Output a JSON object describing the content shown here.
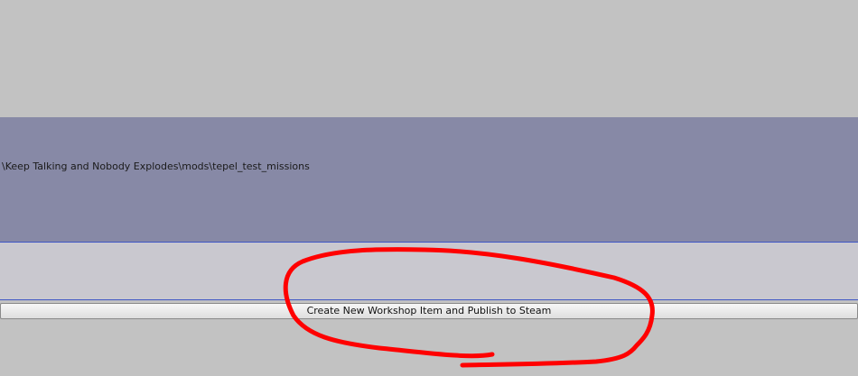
{
  "path_panel": {
    "path": "\\Keep Talking and Nobody Explodes\\mods\\tepel_test_missions"
  },
  "actions": {
    "publish_label": "Create New Workshop Item and Publish to Steam"
  },
  "annotation": {
    "color": "#ff0000"
  },
  "colors": {
    "background": "#c2c2c2",
    "path_panel": "#8789a6",
    "strip": "#c9c8cf",
    "separator": "#3d55c4"
  }
}
